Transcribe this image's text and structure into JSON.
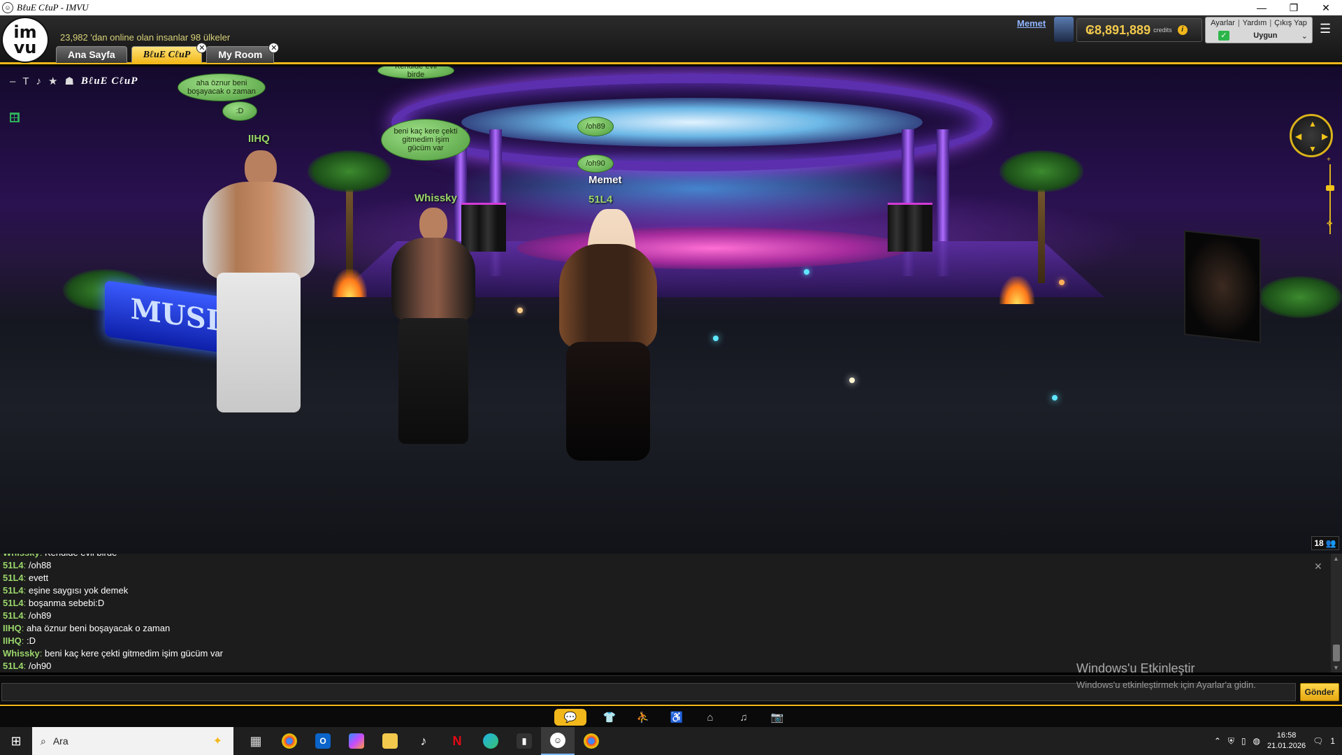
{
  "window": {
    "title": "BℓuE CℓuP - IMVU",
    "minimize": "—",
    "maximize": "❐",
    "close": "✕"
  },
  "header": {
    "logo_line1": "im",
    "logo_line2": "vu",
    "online_text": "23,982 'dan online olan insanlar 98 ülkeler",
    "tabs": [
      {
        "label": "Ana Sayfa",
        "closable": false
      },
      {
        "label": "BℓuE CℓuP",
        "closable": true,
        "active": true
      },
      {
        "label": "My Room",
        "closable": true
      }
    ],
    "user_name": "Memet",
    "credits_value": "8,891,889",
    "credits_label": "credits",
    "links": [
      "Ayarlar",
      "Yardım",
      "Çıkış Yap"
    ],
    "status": "Uygun"
  },
  "scene": {
    "room_name": "BℓuE CℓuP",
    "toolbar_icons": [
      "–",
      "T",
      "♪",
      "★",
      "☗"
    ],
    "avatars": [
      {
        "name": "IIHQ",
        "color": "#9ad66b"
      },
      {
        "name": "Whissky",
        "color": "#9ad66b"
      },
      {
        "name": "Memet",
        "color": "#ffffff"
      },
      {
        "name": "51L4",
        "color": "#9ad66b"
      }
    ],
    "bubbles": [
      {
        "text": "Kendide evli birde"
      },
      {
        "text": "aha öznur beni boşayacak o zaman"
      },
      {
        "text": ":D"
      },
      {
        "text": "beni kaç kere çekti gitmedim işim gücüm var"
      },
      {
        "text": "/oh89"
      },
      {
        "text": "/oh90"
      }
    ],
    "sign_text": "MUSI",
    "people_count": "18"
  },
  "chat": {
    "lines": [
      {
        "speaker": "Whissky",
        "message": "Kendide evli birde",
        "color": "#9ad66b"
      },
      {
        "speaker": "51L4",
        "message": "/oh88",
        "color": "#9ad66b"
      },
      {
        "speaker": "51L4",
        "message": "evett",
        "color": "#9ad66b"
      },
      {
        "speaker": "51L4",
        "message": "eşine saygısı yok demek",
        "color": "#9ad66b"
      },
      {
        "speaker": "51L4",
        "message": "boşanma sebebi:D",
        "color": "#9ad66b"
      },
      {
        "speaker": "51L4",
        "message": "/oh89",
        "color": "#9ad66b"
      },
      {
        "speaker": "IIHQ",
        "message": "aha öznur beni boşayacak o zaman",
        "color": "#9ad66b"
      },
      {
        "speaker": "IIHQ",
        "message": ":D",
        "color": "#9ad66b"
      },
      {
        "speaker": "Whissky",
        "message": "beni kaç kere çekti gitmedim işim gücüm var",
        "color": "#9ad66b"
      },
      {
        "speaker": "51L4",
        "message": "/oh90",
        "color": "#9ad66b"
      }
    ],
    "input_value": "",
    "send_label": "Gönder",
    "activate_title": "Windows'u Etkinleştir",
    "activate_sub": "Windows'u etkinleştirmek için Ayarlar'a gidin."
  },
  "mode_bar": [
    "chat-icon",
    "shirt-icon",
    "avatar-icon",
    "pose-icon",
    "home-icon",
    "music-icon",
    "camera-icon"
  ],
  "taskbar": {
    "search_placeholder": "Ara",
    "time": "16:58",
    "date": "21.01.2026",
    "notification_count": "1"
  },
  "colors": {
    "accent": "#f2b81b",
    "name_green": "#9ad66b"
  }
}
